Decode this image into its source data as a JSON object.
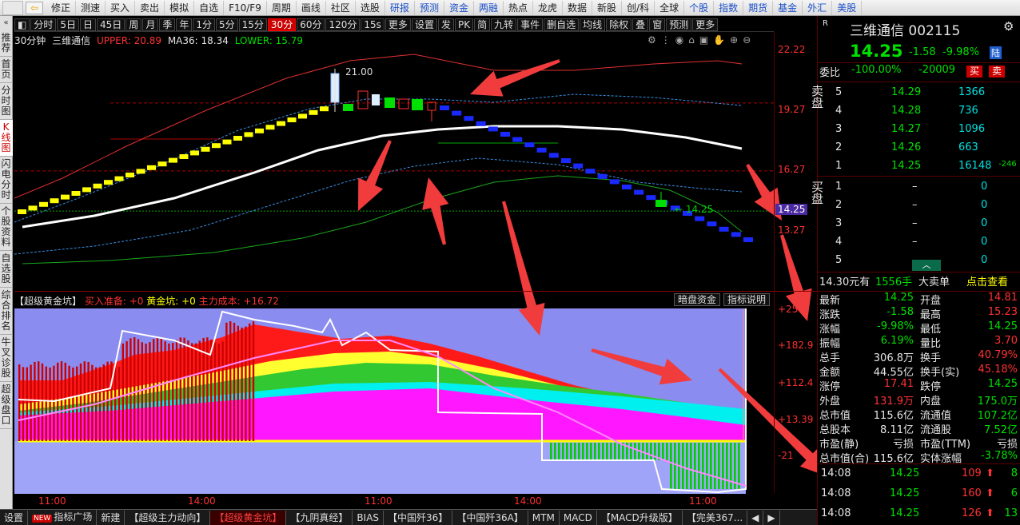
{
  "topbar": {
    "items": [
      {
        "label": "修正",
        "blue": false
      },
      {
        "label": "测速",
        "blue": false
      },
      {
        "label": "买入",
        "blue": false
      },
      {
        "label": "卖出",
        "blue": false
      },
      {
        "label": "模拟",
        "blue": false
      },
      {
        "label": "自选",
        "blue": false
      },
      {
        "label": "F10/F9",
        "blue": false
      },
      {
        "label": "周期",
        "blue": false
      },
      {
        "label": "画线",
        "blue": false
      },
      {
        "label": "社区",
        "blue": false
      },
      {
        "label": "选股",
        "blue": false
      },
      {
        "label": "研报",
        "blue": true
      },
      {
        "label": "预测",
        "blue": true
      },
      {
        "label": "资金",
        "blue": true
      },
      {
        "label": "两融",
        "blue": true
      },
      {
        "label": "热点",
        "blue": false
      },
      {
        "label": "龙虎",
        "blue": false
      },
      {
        "label": "数据",
        "blue": false
      },
      {
        "label": "新股",
        "blue": false
      },
      {
        "label": "创/科",
        "blue": false
      },
      {
        "label": "全球",
        "blue": false
      },
      {
        "label": "个股",
        "blue": true
      },
      {
        "label": "指数",
        "blue": true
      },
      {
        "label": "期货",
        "blue": true
      },
      {
        "label": "基金",
        "blue": true
      },
      {
        "label": "外汇",
        "blue": true
      },
      {
        "label": "美股",
        "blue": true
      }
    ]
  },
  "leftnav": {
    "top_arrow": "«",
    "items": [
      "推荐",
      "首页",
      "分时图",
      "K线图",
      "闪电分时",
      "个股资料",
      "自选股",
      "综合排名",
      "牛叉诊股",
      "超级盘口"
    ],
    "active": 3
  },
  "toolbar": {
    "buttons": [
      "分时",
      "5日",
      "日",
      "45日",
      "周",
      "月",
      "季",
      "年",
      "1分",
      "5分",
      "15分",
      "30分",
      "60分",
      "120分",
      "15s",
      "更多",
      "设置",
      "发",
      "PK",
      "简",
      "九转",
      "事件",
      "删自选",
      "均线",
      "除权",
      "叠",
      "窗",
      "预测",
      "更多"
    ],
    "selected": "30分"
  },
  "info": {
    "period": "30分钟",
    "name": "三维通信",
    "upper": "UPPER: 20.89",
    "ma": "MA36: 18.34",
    "lower": "LOWER: 15.79"
  },
  "icons": [
    "gear-icon",
    "eye-icon",
    "home-icon",
    "trash-icon",
    "hand-icon",
    "zoom-in-icon",
    "zoom-out-icon"
  ],
  "price_axis": [
    "22.22",
    "19.27",
    "16.27",
    "14.25",
    "13.27"
  ],
  "annotations": {
    "high": "21.00",
    "last": "14.25"
  },
  "indicator": {
    "title": "【超级黄金坑】",
    "buy": "买入准备: +0",
    "pit": "黄金坑: +0",
    "cost": "主力成本: +16.72",
    "btn1": "暗盘资金",
    "btn2": "指标说明",
    "axis": [
      "+25",
      "+182.9",
      "+112.4",
      "+13.39",
      "-21"
    ]
  },
  "time_axis": [
    "11:00",
    "14:00",
    "11:00",
    "14:00",
    "11:00"
  ],
  "bottom_tabs": [
    {
      "label": "设置",
      "new": false
    },
    {
      "label": "指标广场",
      "new": true
    },
    {
      "label": "新建",
      "new": false
    },
    {
      "label": "【超级主力动向】",
      "new": false
    },
    {
      "label": "【超级黄金坑】",
      "new": false,
      "active": true
    },
    {
      "label": "【九阴真经】",
      "new": false
    },
    {
      "label": "BIAS",
      "new": false
    },
    {
      "label": "【中国歼36】",
      "new": false
    },
    {
      "label": "【中国歼36A】",
      "new": false
    },
    {
      "label": "MTM",
      "new": false
    },
    {
      "label": "MACD",
      "new": false
    },
    {
      "label": "【MACD升级版】",
      "new": false
    },
    {
      "label": "【完美367...",
      "new": false
    }
  ],
  "quote": {
    "r": "R",
    "name": "三维通信 002115",
    "price": "14.25",
    "change": "-1.58",
    "pct": "-9.98%",
    "badge": "陆",
    "wb_label": "委比",
    "wb": "-100.00%",
    "wc": "-20009",
    "buy_btn": "买",
    "sell_btn": "卖",
    "sell_side": "卖盘",
    "buy_side": "买盘",
    "asks": [
      {
        "lvl": "5",
        "p": "14.29",
        "v": "1366",
        "d": ""
      },
      {
        "lvl": "4",
        "p": "14.28",
        "v": "736",
        "d": ""
      },
      {
        "lvl": "3",
        "p": "14.27",
        "v": "1096",
        "d": ""
      },
      {
        "lvl": "2",
        "p": "14.26",
        "v": "663",
        "d": ""
      },
      {
        "lvl": "1",
        "p": "14.25",
        "v": "16148",
        "d": "-246"
      }
    ],
    "bids": [
      {
        "lvl": "1",
        "p": "–",
        "v": "0"
      },
      {
        "lvl": "2",
        "p": "–",
        "v": "0"
      },
      {
        "lvl": "3",
        "p": "–",
        "v": "0"
      },
      {
        "lvl": "4",
        "p": "–",
        "v": "0"
      },
      {
        "lvl": "5",
        "p": "–",
        "v": "0"
      }
    ],
    "big_order": {
      "price": "14.30元有",
      "qty": "1556手",
      "label": "大卖单",
      "link": "点击查看"
    },
    "stats": [
      {
        "l1": "最新",
        "v1": "14.25",
        "l2": "开盘",
        "v2": "14.81"
      },
      {
        "l1": "涨跌",
        "v1": "-1.58",
        "l2": "最高",
        "v2": "15.23"
      },
      {
        "l1": "涨幅",
        "v1": "-9.98%",
        "l2": "最低",
        "v2": "14.25"
      },
      {
        "l1": "振幅",
        "v1": "6.19%",
        "l2": "量比",
        "v2": "3.70"
      },
      {
        "l1": "总手",
        "v1": "306.8万",
        "l2": "换手",
        "v2": "40.79%"
      },
      {
        "l1": "金额",
        "v1": "44.55亿",
        "l2": "换手(实)",
        "v2": "45.18%"
      },
      {
        "l1": "涨停",
        "v1": "17.41",
        "l2": "跌停",
        "v2": "14.25"
      },
      {
        "l1": "外盘",
        "v1": "131.9万",
        "l2": "内盘",
        "v2": "175.0万"
      },
      {
        "l1": "总市值",
        "v1": "115.6亿",
        "l2": "流通值",
        "v2": "107.2亿"
      },
      {
        "l1": "总股本",
        "v1": "8.11亿",
        "l2": "流通股",
        "v2": "7.52亿"
      },
      {
        "l1": "市盈(静)",
        "v1": "亏损",
        "l2": "市盈(TTM)",
        "v2": "亏损"
      },
      {
        "l1": "总市值(合)",
        "v1": "115.6亿",
        "l2": "实体涨幅",
        "v2": "-3.78%"
      }
    ],
    "ticks": [
      {
        "t": "14:08",
        "p": "14.25",
        "v": "109",
        "n": "8"
      },
      {
        "t": "14:08",
        "p": "14.25",
        "v": "160",
        "n": "6"
      },
      {
        "t": "14:08",
        "p": "14.25",
        "v": "126",
        "n": "13"
      }
    ]
  }
}
